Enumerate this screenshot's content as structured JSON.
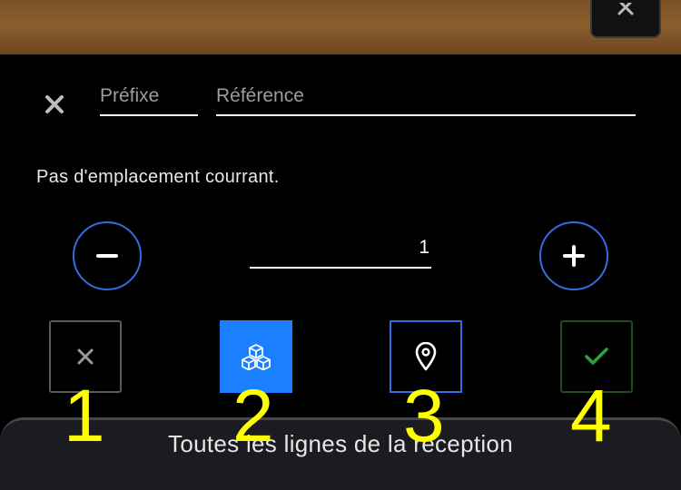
{
  "form": {
    "prefix_placeholder": "Préfixe",
    "prefix_value": "",
    "reference_placeholder": "Référence",
    "reference_value": ""
  },
  "location_message": "Pas d'emplacement courrant.",
  "quantity": {
    "value": "1"
  },
  "actions": [
    {
      "name": "cancel",
      "icon": "close-icon"
    },
    {
      "name": "products",
      "icon": "cubes-icon"
    },
    {
      "name": "location",
      "icon": "map-pin-icon"
    },
    {
      "name": "validate",
      "icon": "check-icon"
    }
  ],
  "bottom_sheet": {
    "label": "Toutes les lignes de la reception"
  },
  "annotations": [
    "1",
    "2",
    "3",
    "4"
  ],
  "colors": {
    "accent_blue": "#1a80ff",
    "outline_blue": "#2f6fe0",
    "success_green": "#2ea043",
    "annotation_yellow": "#ffff00"
  }
}
